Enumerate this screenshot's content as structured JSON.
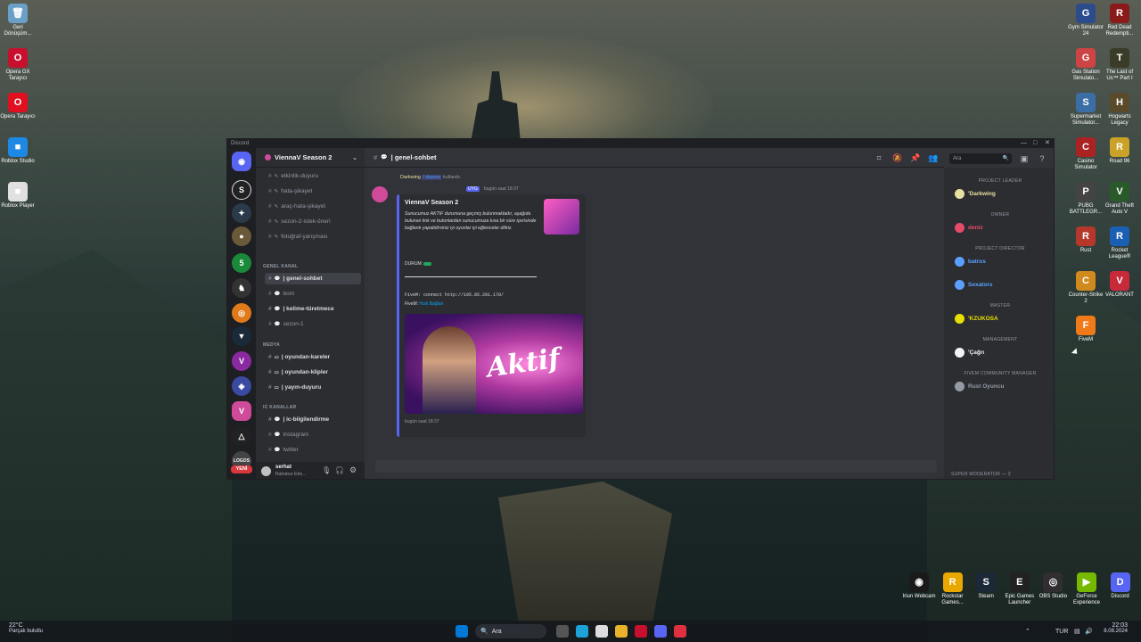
{
  "desktop": {
    "left_icons": [
      {
        "label": "Geri Dönüşüm...",
        "color": "#6aa0c8",
        "glyph": "🗑"
      },
      {
        "label": "Opera GX Tarayıcı",
        "color": "#c8102e",
        "glyph": "O"
      },
      {
        "label": "Opera Tarayıcı",
        "color": "#e01020",
        "glyph": "O"
      },
      {
        "label": "Roblox Studio",
        "color": "#1e88e5",
        "glyph": "■"
      },
      {
        "label": "Roblox Player",
        "color": "#e0e0e0",
        "glyph": "■"
      }
    ],
    "right_icons": [
      {
        "label": "Gym Simulator 24",
        "color": "#2b4c8c",
        "glyph": "G"
      },
      {
        "label": "Red Dead Redempti...",
        "color": "#8b1a1a",
        "glyph": "R"
      },
      {
        "label": "Gas Station Simulato...",
        "color": "#c44",
        "glyph": "G"
      },
      {
        "label": "The Last of Us™ Part I",
        "color": "#3b3b2a",
        "glyph": "T"
      },
      {
        "label": "Supermarket Simulator...",
        "color": "#3a6ea5",
        "glyph": "S"
      },
      {
        "label": "Hogwarts Legacy",
        "color": "#5a4a2a",
        "glyph": "H"
      },
      {
        "label": "Casino Simulator",
        "color": "#aa2222",
        "glyph": "C"
      },
      {
        "label": "Road 96",
        "color": "#c9a227",
        "glyph": "R"
      },
      {
        "label": "PUBG BATTLEGR...",
        "color": "#444",
        "glyph": "P"
      },
      {
        "label": "Grand Theft Auto V",
        "color": "#2a5a2a",
        "glyph": "V"
      },
      {
        "label": "Rust",
        "color": "#b5382a",
        "glyph": "R"
      },
      {
        "label": "Rocket League®",
        "color": "#1b5fb5",
        "glyph": "R"
      },
      {
        "label": "Counter-Strike 2",
        "color": "#d08a1e",
        "glyph": "C"
      },
      {
        "label": "VALORANT",
        "color": "#c92a3a",
        "glyph": "V"
      },
      {
        "label": "FiveM",
        "color": "#f07a1a",
        "glyph": "F"
      }
    ],
    "bottom_icons": [
      {
        "label": "Iriun Webcam",
        "color": "#1a1a1a",
        "glyph": "◉"
      },
      {
        "label": "Rockstar Games...",
        "color": "#e8a800",
        "glyph": "R"
      },
      {
        "label": "Steam",
        "color": "#1b2838",
        "glyph": "S"
      },
      {
        "label": "Epic Games Launcher",
        "color": "#222",
        "glyph": "E"
      },
      {
        "label": "OBS Studio",
        "color": "#302e31",
        "glyph": "◎"
      },
      {
        "label": "GeForce Experience",
        "color": "#76b900",
        "glyph": "▶"
      },
      {
        "label": "Discord",
        "color": "#5865f2",
        "glyph": "D"
      }
    ]
  },
  "taskbar": {
    "weather_temp": "22°C",
    "weather_desc": "Parçalı bulutlu",
    "search_label": "Ara",
    "lang": "TUR",
    "time": "22:03",
    "date": "8.08.2024"
  },
  "discord": {
    "title": "Discord",
    "guild_name": "ViennaV Season 2",
    "current_channel": "| genel-sohbet",
    "search_placeholder": "Ara",
    "channels_top": [
      {
        "name": "etkinlik-duyuru"
      },
      {
        "name": "hata-şikayet"
      },
      {
        "name": "araç-hata-şikayet"
      },
      {
        "name": "sezon-2-istek-öneri"
      },
      {
        "name": "fotoğraf-yarışması"
      }
    ],
    "category_general": "GENEL KANAL",
    "channels_general": [
      {
        "name": "| genel-sohbet",
        "active": true
      },
      {
        "name": "bom",
        "active": false
      },
      {
        "name": "| kelime-türetmece",
        "active": false
      },
      {
        "name": "sezon-1",
        "active": false
      }
    ],
    "category_media": "MEDYA",
    "channels_media": [
      {
        "name": "| oyundan-kareler"
      },
      {
        "name": "| oyundan-klipler"
      },
      {
        "name": "| yayın-duyuru"
      }
    ],
    "category_ic": "IC KANALLAR",
    "channels_ic": [
      {
        "name": "| ic-bilgilendirme"
      },
      {
        "name": "Instagram"
      },
      {
        "name": "twitter"
      }
    ],
    "user": {
      "name": "serhat",
      "status": "Rahatsız Etm..."
    },
    "new_badge": "YENİ",
    "message": {
      "reply_user": "Darkwing",
      "reply_cmd": "/ duyuru",
      "reply_suffix": "kullandı.",
      "author_tag": "UYG",
      "time": "bugün saat 18:37",
      "embed_title": "ViennaV Season 2",
      "embed_text": "Sunucumuz AKTIF durumuna geçmiş bulunmaktadır, aşağıda bulunan link ve butonlardan sunucumuza kısa bir süre içerisinde bağlantı yapabilirsiniz iyi oyunlar iyi eğlenceler diliriz.",
      "durum_label": "DURUM:",
      "connect_text": "FiveM: connect http://195.85.201.178/",
      "quick_label": "FiveM:",
      "quick_link": "Hızlı Bağlan",
      "banner_text": "Aktif",
      "footer": "bugün saat 18:37"
    },
    "members": [
      {
        "category": "PROJECT LEADER",
        "name": "'Darkwing",
        "color": "#e8e0a0"
      },
      {
        "category": "OWNER",
        "name": "deniz",
        "color": "#e84a6a"
      },
      {
        "category": "PROJECT DIRECTOR",
        "name": "batros",
        "color": "#5aa0ff"
      },
      {
        "category": "",
        "name": "Sexators",
        "color": "#5aa0ff"
      },
      {
        "category": "MASTER",
        "name": "'KZUKOSA",
        "color": "#e8e000"
      },
      {
        "category": "MANAGEMENT",
        "name": "'Çağrı",
        "color": "#f2f3f5"
      },
      {
        "category": "FIVEM COMMUNITY MANAGER",
        "name": "Rust Oyuncu",
        "color": "#949ba4"
      }
    ],
    "member_last_cat": "SUPER MODERATOR — 2"
  }
}
